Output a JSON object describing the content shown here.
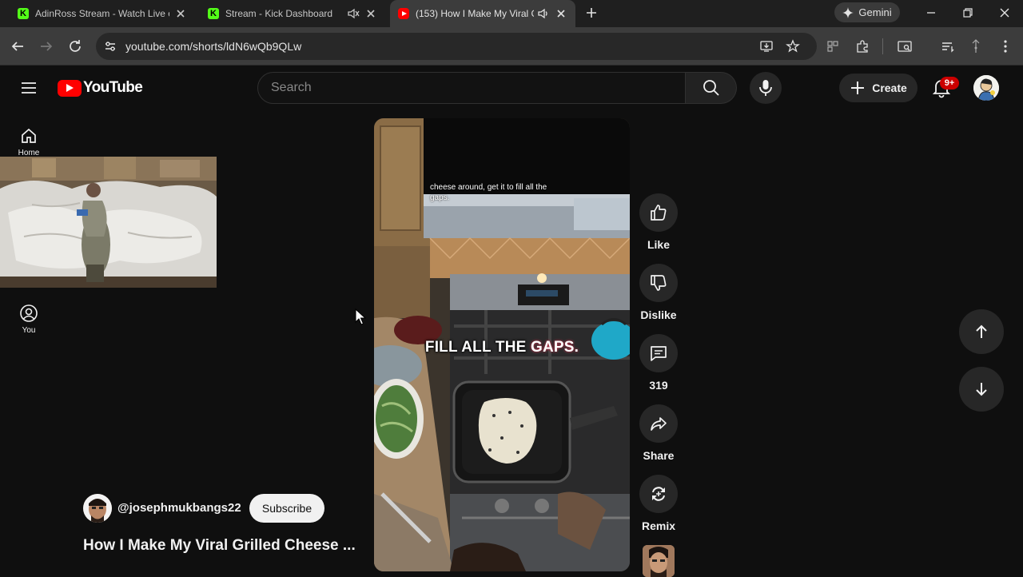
{
  "browser": {
    "tabs": [
      {
        "title": "AdinRoss Stream - Watch Live o",
        "favicon": "kick-icon"
      },
      {
        "title": "Stream - Kick Dashboard",
        "favicon": "kick-icon"
      },
      {
        "title": "(153) How I Make My Viral G",
        "favicon": "youtube-icon",
        "active": true
      }
    ],
    "gemini_label": "Gemini",
    "url": "youtube.com/shorts/ldN6wQb9QLw"
  },
  "youtube": {
    "logo_text": "YouTube",
    "search_placeholder": "Search",
    "create_label": "Create",
    "notification_count": "9+"
  },
  "guide": {
    "home_label": "Home",
    "you_label": "You"
  },
  "short": {
    "caption_small": "cheese around, get it to fill all the gaps.",
    "caption_big_prefix": "FILL ALL THE ",
    "caption_big_highlight": "GAPS.",
    "channel": "@josephmukbangs22",
    "subscribe_label": "Subscribe",
    "title": "How I Make My Viral Grilled Cheese ...",
    "actions": {
      "like": "Like",
      "dislike": "Dislike",
      "comments": "319",
      "share": "Share",
      "remix": "Remix"
    }
  },
  "colors": {
    "background": "#0f0f0f",
    "youtube_red": "#ff0000",
    "kick_green": "#53fc18",
    "highlight": "#ff4d6d"
  }
}
